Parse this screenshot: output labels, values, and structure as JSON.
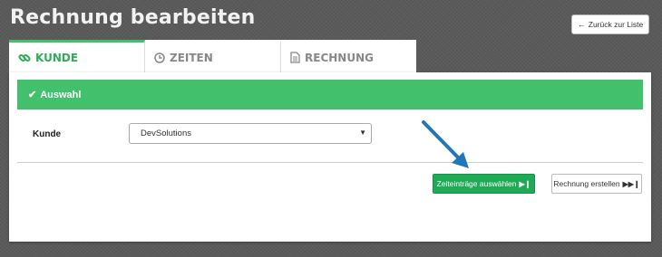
{
  "header": {
    "title": "Rechnung bearbeiten",
    "back_button_label": "Zurück zur Liste",
    "back_icon": "arrow-left-icon"
  },
  "tabs": [
    {
      "label": "KUNDE",
      "icon": "link-icon",
      "active": true
    },
    {
      "label": "ZEITEN",
      "icon": "clock-icon",
      "active": false
    },
    {
      "label": "RECHNUNG",
      "icon": "document-icon",
      "active": false
    }
  ],
  "section": {
    "title": "Auswahl",
    "icon": "checkmark-icon"
  },
  "form": {
    "customer_label": "Kunde",
    "customer_value": "DevSolutions"
  },
  "actions": {
    "select_entries_label": "Zeiteinträge auswählen",
    "create_invoice_label": "Rechnung erstellen"
  },
  "colors": {
    "accent": "#42c06b",
    "primary_button": "#1fab55",
    "annotation_arrow": "#1f76b8",
    "background": "#5a5a5a"
  }
}
